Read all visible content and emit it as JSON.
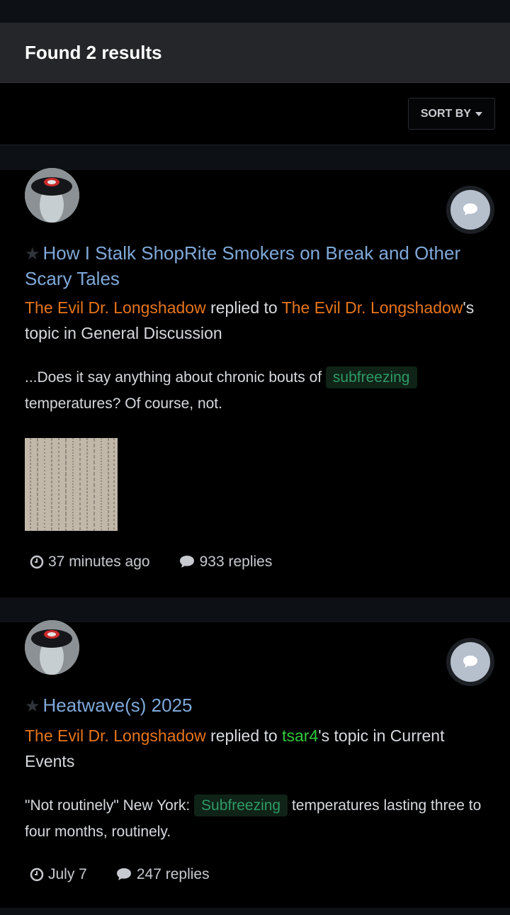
{
  "header": {
    "title": "Found 2 results"
  },
  "sort": {
    "label": "SORT BY"
  },
  "results": [
    {
      "title": "How I Stalk ShopRite Smokers on Break and Other Scary Tales",
      "author": "The Evil Dr. Longshadow",
      "action": "replied to",
      "topic_owner": "The Evil Dr. Longshadow",
      "topic_suffix": "'s topic in General Discussion",
      "snippet_before": "...Does it say anything about chronic bouts of",
      "highlight": "subfreezing",
      "snippet_after": "temperatures? Of course, not.",
      "time": "37 minutes ago",
      "replies": "933 replies"
    },
    {
      "title": "Heatwave(s) 2025",
      "author": "The Evil Dr. Longshadow",
      "action": "replied to",
      "topic_owner": "tsar4",
      "topic_suffix": "'s topic in Current Events",
      "snippet_before": "\"Not routinely\" New York:",
      "highlight": "Subfreezing",
      "snippet_after": "temperatures lasting three to four months, routinely.",
      "time": "July 7",
      "replies": "247 replies"
    }
  ]
}
